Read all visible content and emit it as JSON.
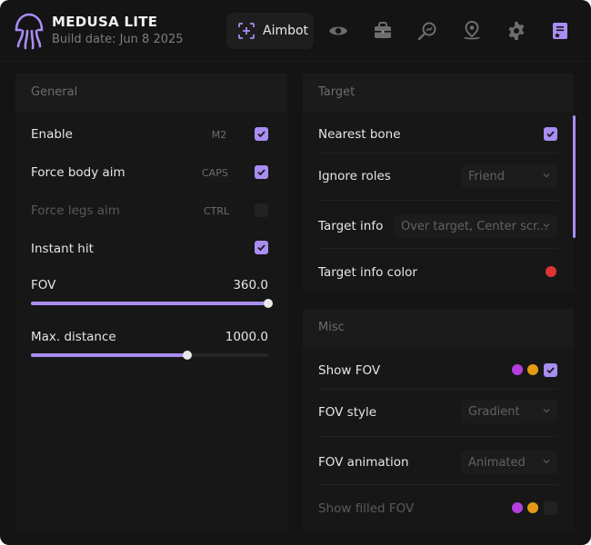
{
  "app": {
    "title": "MEDUSA LITE",
    "build_date": "Build date: Jun 8 2025"
  },
  "tabs": [
    {
      "label": "Aimbot",
      "icon": "crosshair-icon",
      "active": true
    },
    {
      "icon": "eye-icon"
    },
    {
      "icon": "briefcase-icon"
    },
    {
      "icon": "search-chart-icon"
    },
    {
      "icon": "location-pin-icon"
    },
    {
      "icon": "gear-icon"
    },
    {
      "icon": "document-star-icon"
    }
  ],
  "colors": {
    "accent": "#a98df2",
    "purple": "#b43ee0",
    "orange": "#e39b13",
    "red": "#e03434"
  },
  "general": {
    "title": "General",
    "enable": {
      "label": "Enable",
      "key": "M2",
      "checked": true
    },
    "force_body": {
      "label": "Force body aim",
      "key": "CAPS",
      "checked": true
    },
    "force_legs": {
      "label": "Force legs aim",
      "key": "CTRL",
      "checked": false
    },
    "instant_hit": {
      "label": "Instant hit",
      "checked": true
    },
    "fov": {
      "label": "FOV",
      "value": "360.0",
      "fraction": 1.0
    },
    "max_distance": {
      "label": "Max. distance",
      "value": "1000.0",
      "fraction": 0.66
    }
  },
  "target": {
    "title": "Target",
    "nearest_bone": {
      "label": "Nearest bone",
      "checked": true
    },
    "ignore_roles": {
      "label": "Ignore roles",
      "selected": "Friend"
    },
    "target_info": {
      "label": "Target info",
      "selected": "Over target, Center scr..."
    },
    "target_info_color": {
      "label": "Target info color"
    }
  },
  "misc": {
    "title": "Misc",
    "show_fov": {
      "label": "Show FOV",
      "checked": true
    },
    "fov_style": {
      "label": "FOV style",
      "selected": "Gradient"
    },
    "fov_animation": {
      "label": "FOV animation",
      "selected": "Animated"
    },
    "show_filled_fov": {
      "label": "Show filled FOV",
      "checked": false
    }
  }
}
